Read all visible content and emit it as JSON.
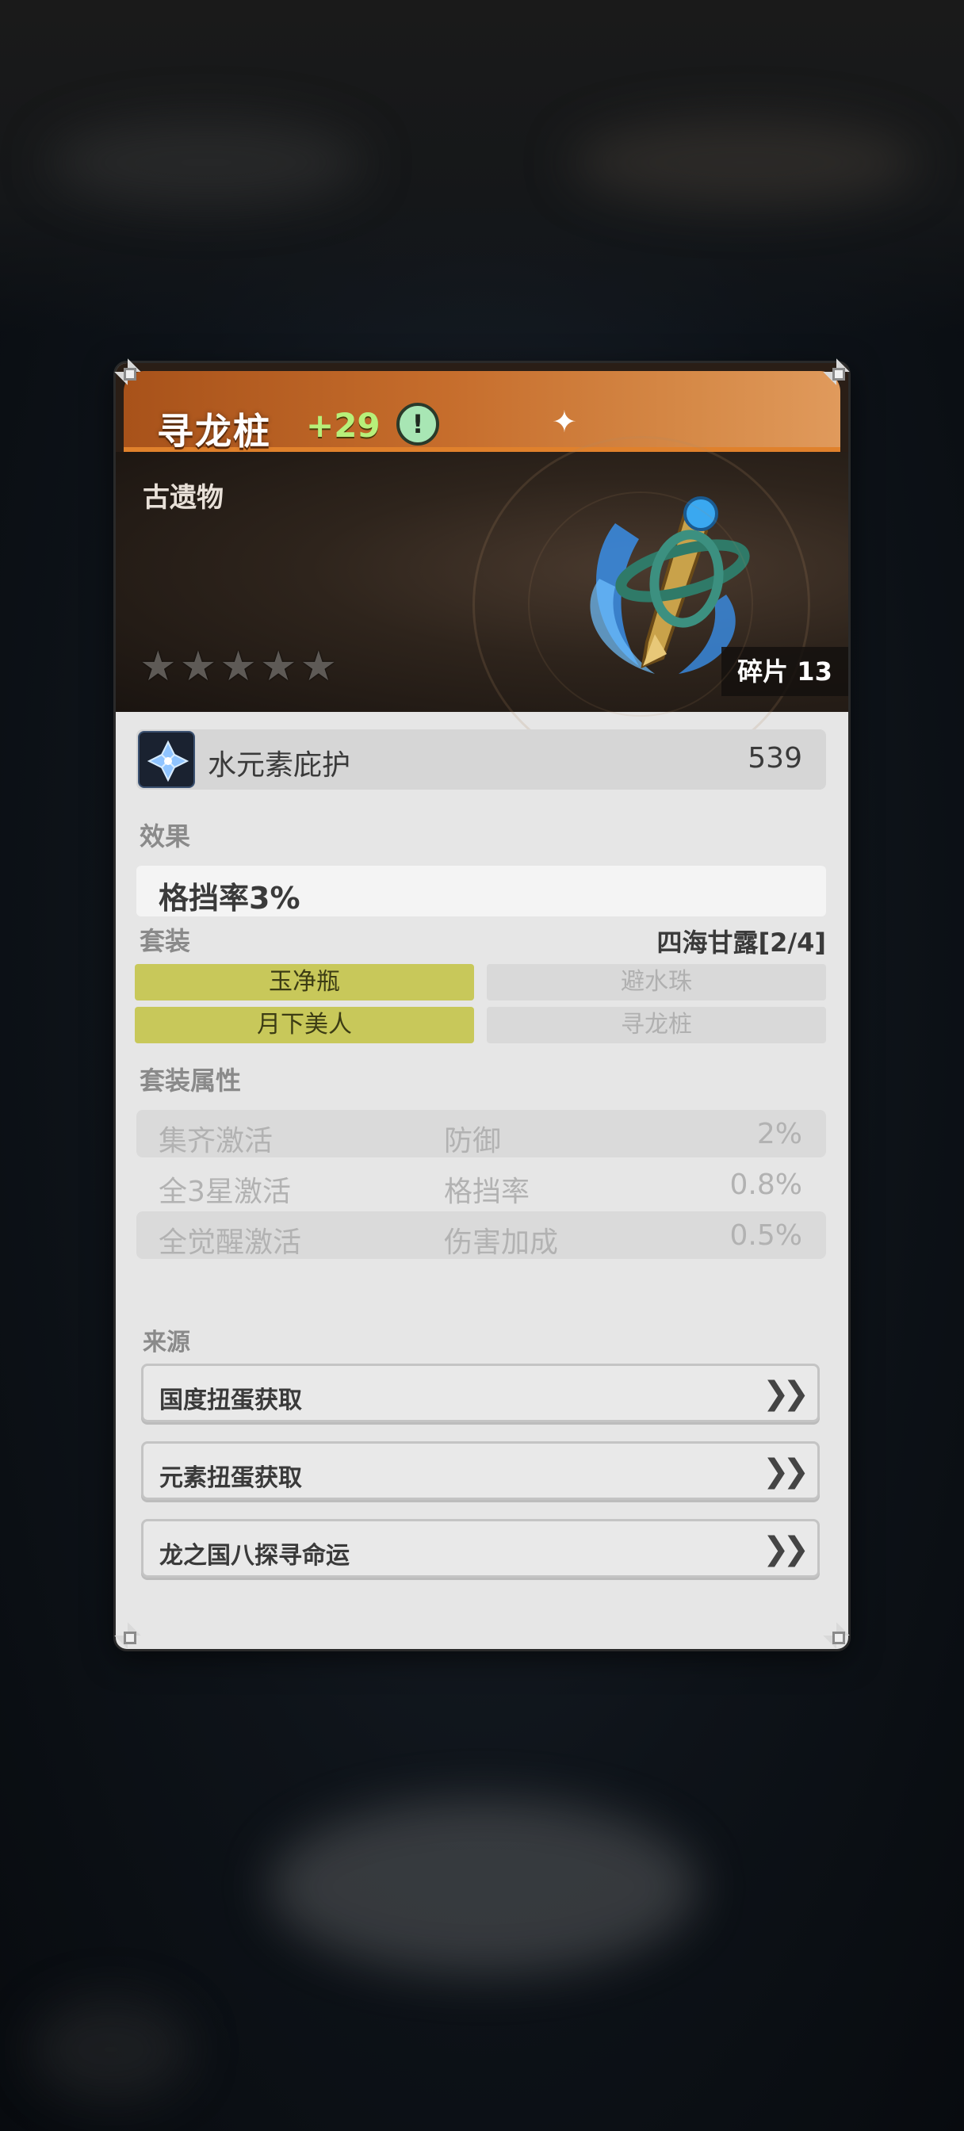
{
  "item": {
    "name": "寻龙桩",
    "level": "+29",
    "info_icon": "!",
    "category": "古遗物",
    "stars": {
      "filled": 0,
      "total": 5
    },
    "fragments": "碎片 13"
  },
  "main_stat": {
    "icon": "water-element-icon",
    "name": "水元素庇护",
    "value": "539"
  },
  "effect": {
    "label": "效果",
    "text": "格挡率3%"
  },
  "set": {
    "label": "套装",
    "name": "四海甘露[2/4]",
    "pieces": [
      {
        "name": "玉净瓶",
        "active": true
      },
      {
        "name": "避水珠",
        "active": false
      },
      {
        "name": "月下美人",
        "active": true
      },
      {
        "name": "寻龙桩",
        "active": false
      }
    ]
  },
  "set_bonus": {
    "label": "套装属性",
    "rows": [
      {
        "condition": "集齐激活",
        "attribute": "防御",
        "value": "2%"
      },
      {
        "condition": "全3星激活",
        "attribute": "格挡率",
        "value": "0.8%"
      },
      {
        "condition": "全觉醒激活",
        "attribute": "伤害加成",
        "value": "0.5%"
      }
    ]
  },
  "sources": {
    "label": "来源",
    "items": [
      {
        "label": "国度扭蛋获取"
      },
      {
        "label": "元素扭蛋获取"
      },
      {
        "label": "龙之国八探寻命运"
      }
    ]
  },
  "colors": {
    "title_bar": "#c66d2c",
    "level_green": "#b7f07a",
    "set_active": "#c8c85a"
  }
}
